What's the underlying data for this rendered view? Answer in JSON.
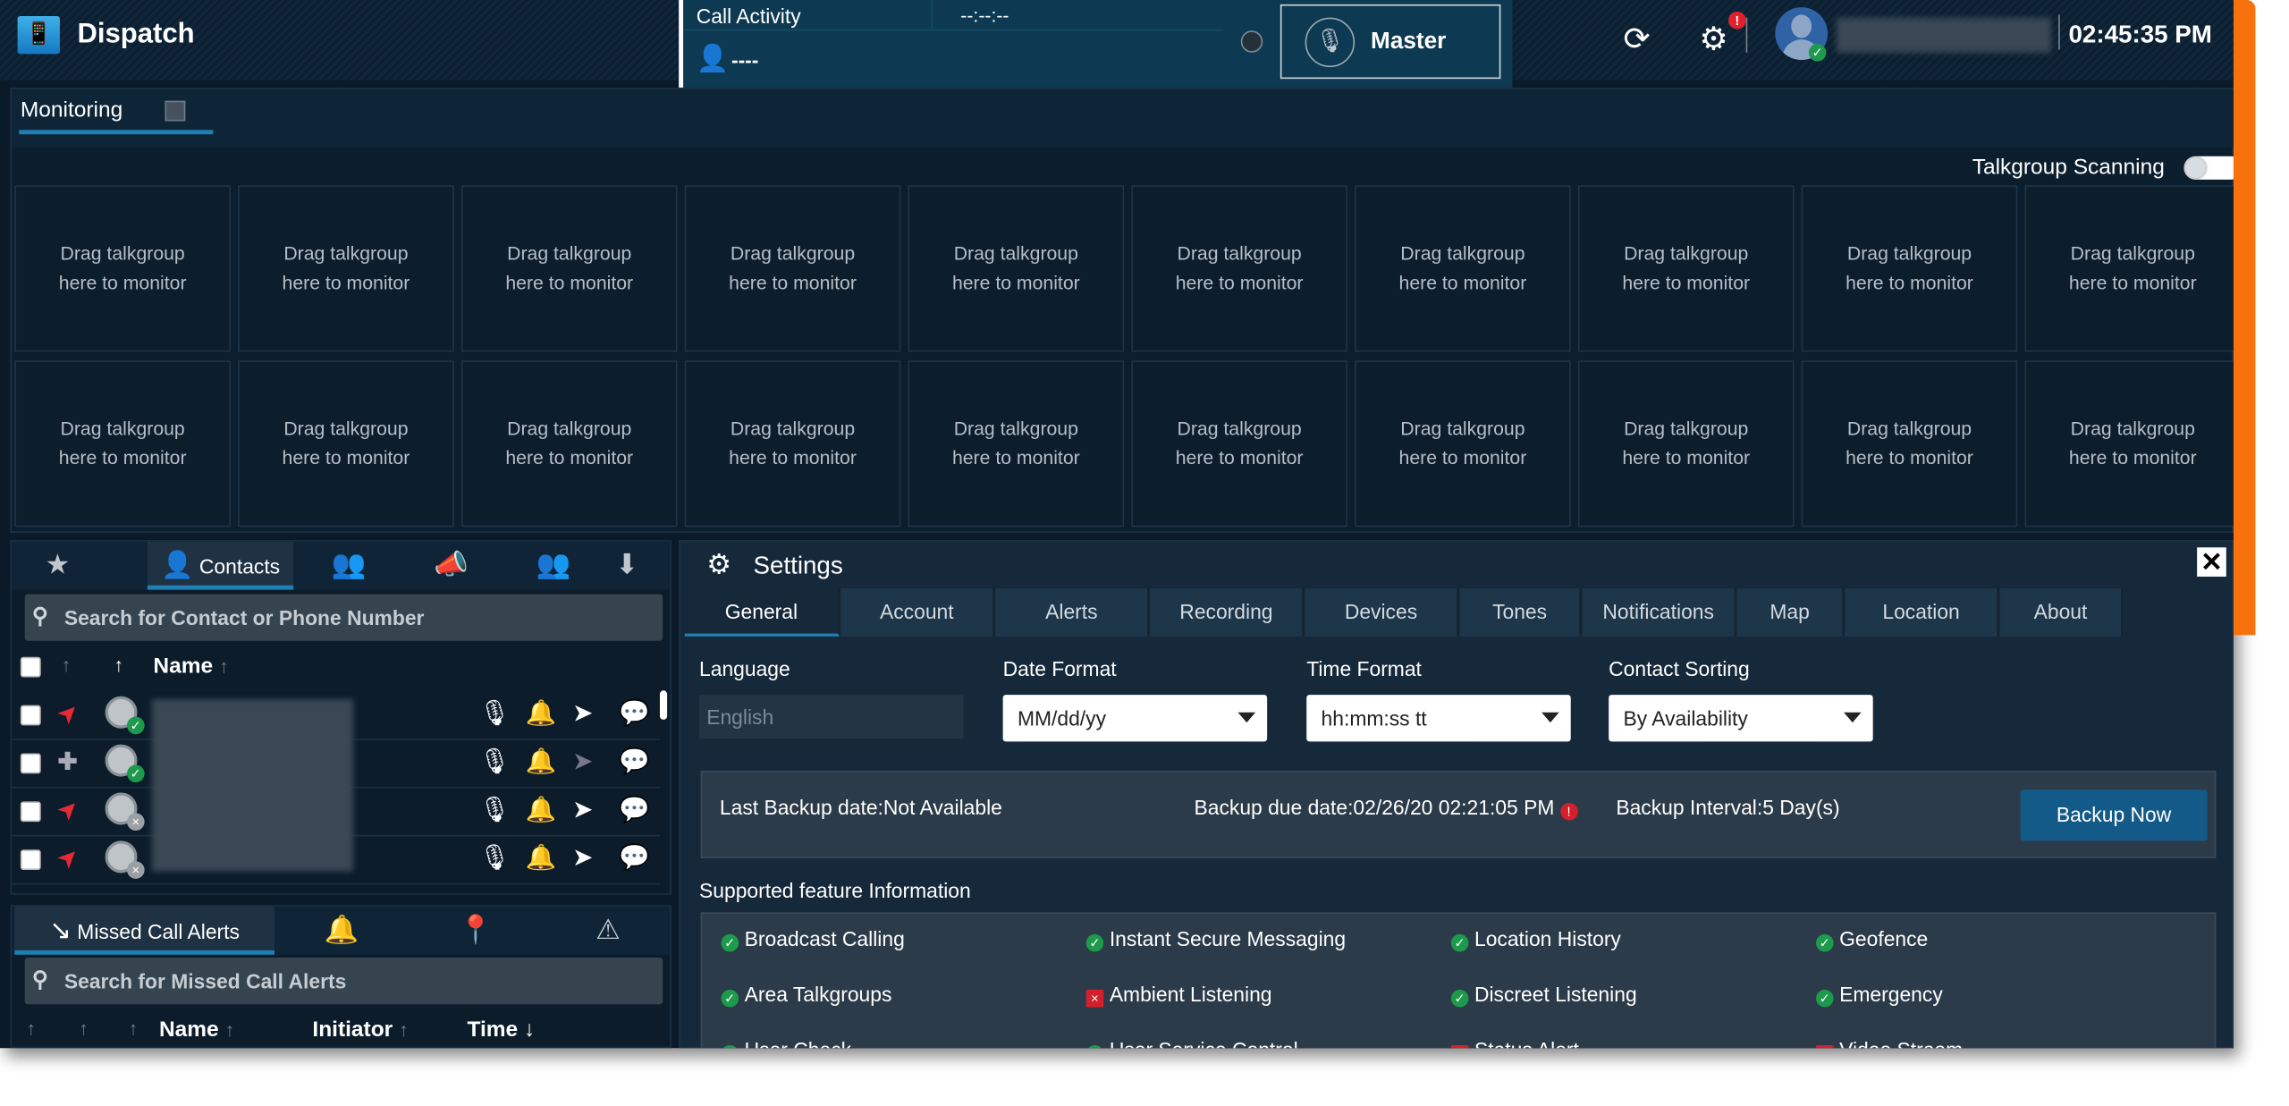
{
  "app": {
    "title": "Dispatch",
    "clock": "02:45:35 PM"
  },
  "call_activity": {
    "title": "Call Activity",
    "timer": "--:--:--",
    "caller": "----",
    "master_label": "Master"
  },
  "monitoring": {
    "tab": "Monitoring",
    "scanning_label": "Talkgroup Scanning",
    "scanning_on": false,
    "slot_text": "Drag talkgroup\nhere to monitor",
    "slot_count": 20
  },
  "contacts": {
    "active_tab": "Contacts",
    "search_placeholder": "Search for Contact or Phone Number",
    "name_header": "Name",
    "rows": [
      {
        "location": "unavailable",
        "presence": "online",
        "message_enabled": true
      },
      {
        "location": "disabled",
        "presence": "online",
        "message_enabled": false
      },
      {
        "location": "unavailable",
        "presence": "offline",
        "message_enabled": false
      },
      {
        "location": "unavailable",
        "presence": "offline",
        "message_enabled": false
      }
    ]
  },
  "missed": {
    "active_tab": "Missed Call Alerts",
    "search_placeholder": "Search for Missed Call Alerts",
    "headers": {
      "name": "Name",
      "initiator": "Initiator",
      "time": "Time"
    }
  },
  "settings": {
    "title": "Settings",
    "tabs": [
      "General",
      "Account",
      "Alerts",
      "Recording",
      "Devices",
      "Tones",
      "Notifications",
      "Map",
      "Location",
      "About"
    ],
    "active_tab": "General",
    "language": {
      "label": "Language",
      "value": "English"
    },
    "date_format": {
      "label": "Date Format",
      "value": "MM/dd/yy"
    },
    "time_format": {
      "label": "Time Format",
      "value": "hh:mm:ss tt"
    },
    "contact_sorting": {
      "label": "Contact Sorting",
      "value": "By Availability"
    },
    "backup": {
      "last": "Last Backup date:Not Available",
      "due": "Backup due date:02/26/20 02:21:05 PM",
      "interval": "Backup Interval:5 Day(s)",
      "button": "Backup Now"
    },
    "features_title": "Supported feature Information",
    "features": [
      {
        "name": "Broadcast Calling",
        "supported": true
      },
      {
        "name": "Instant Secure Messaging",
        "supported": true
      },
      {
        "name": "Location History",
        "supported": true
      },
      {
        "name": "Geofence",
        "supported": true
      },
      {
        "name": "Area Talkgroups",
        "supported": true
      },
      {
        "name": "Ambient Listening",
        "supported": false
      },
      {
        "name": "Discreet Listening",
        "supported": true
      },
      {
        "name": "Emergency",
        "supported": true
      },
      {
        "name": "User Check",
        "supported": true
      },
      {
        "name": "User Service Control",
        "supported": true
      },
      {
        "name": "Status Alert",
        "supported": false
      },
      {
        "name": "Video Stream",
        "supported": false
      }
    ]
  },
  "colors": {
    "accent": "#1f7fb2",
    "scrollbar": "#f7720d",
    "ok": "#1d9a4b",
    "error": "#d4202c"
  }
}
